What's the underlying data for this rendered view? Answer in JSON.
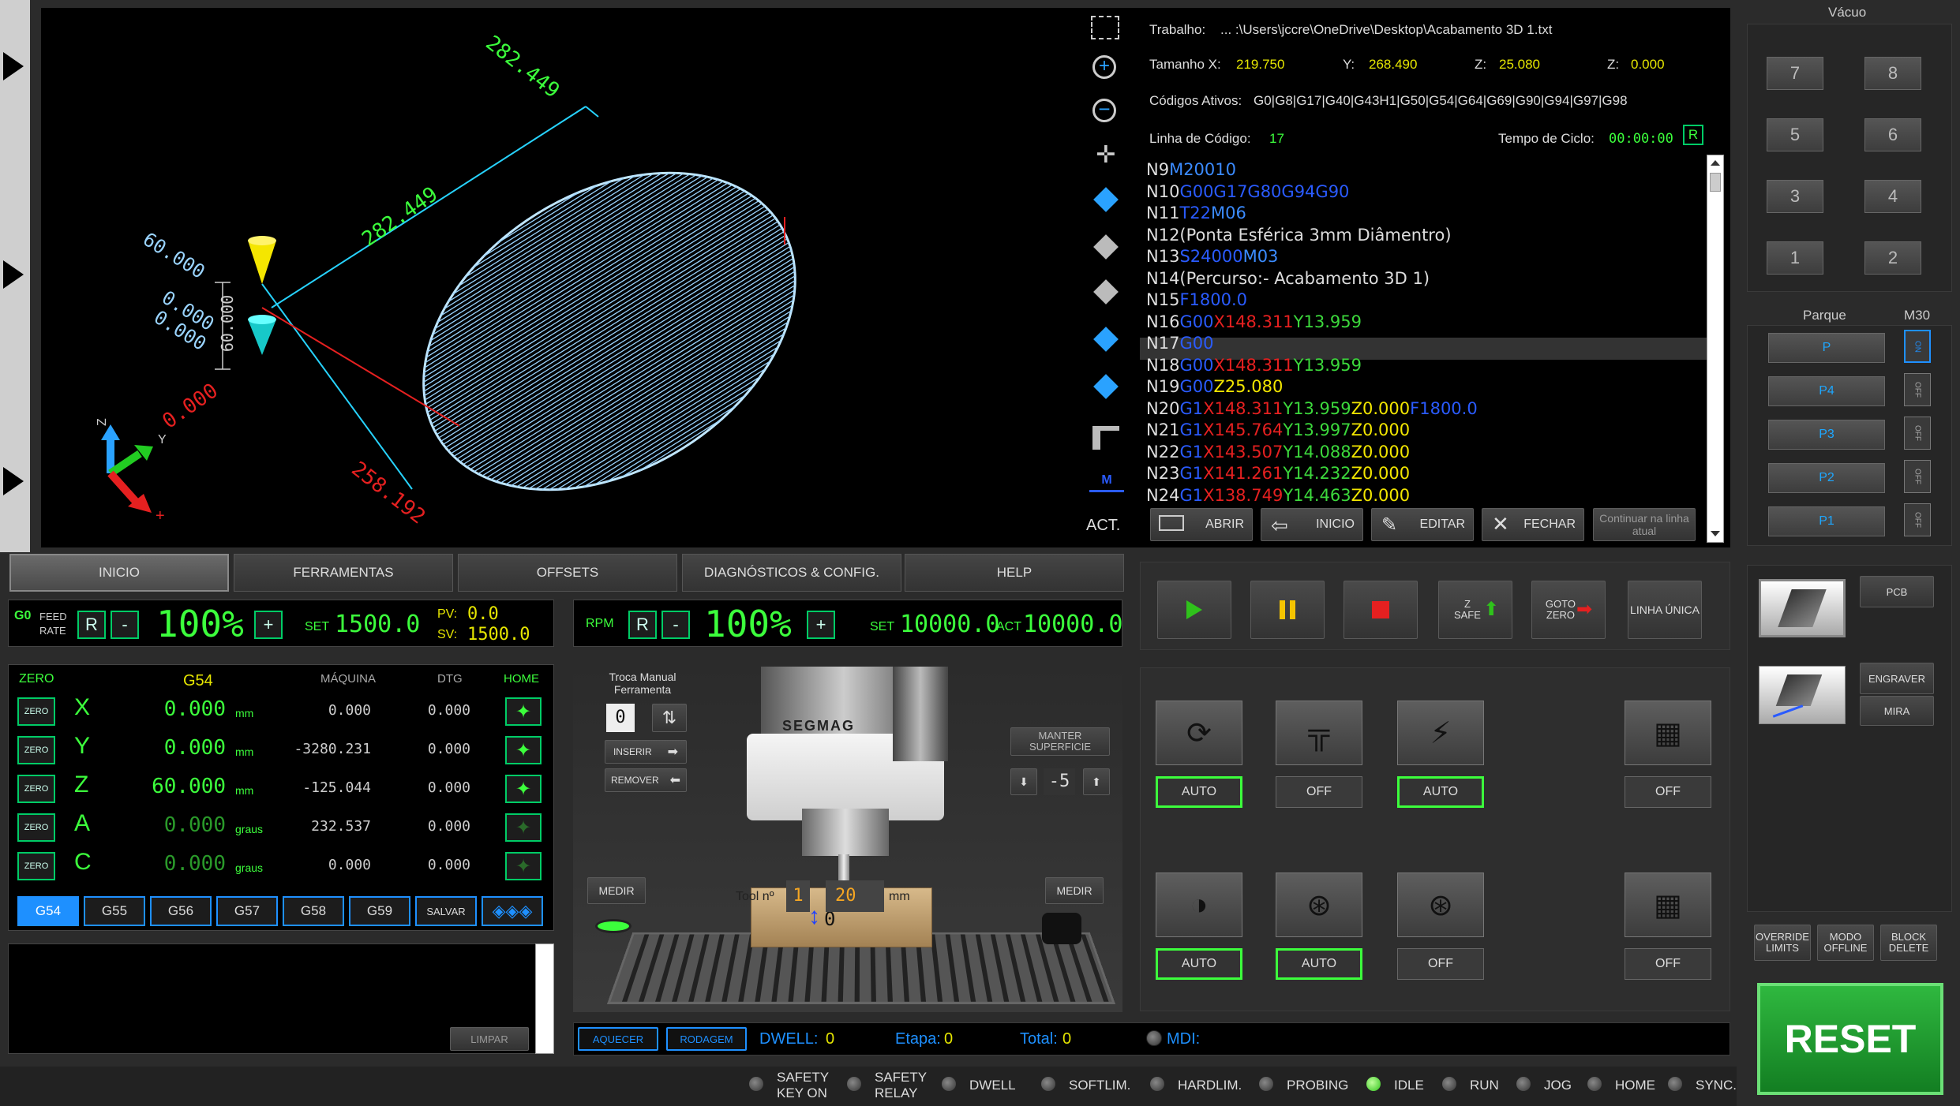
{
  "vacuum": {
    "title": "Vácuo",
    "buttons": [
      "7",
      "8",
      "5",
      "6",
      "3",
      "4",
      "1",
      "2"
    ]
  },
  "park": {
    "title": "Parque",
    "m30": "M30",
    "buttons": [
      "P",
      "P4",
      "P3",
      "P2",
      "P1"
    ],
    "toggle_on": "ON",
    "toggle_off": "OFF"
  },
  "right_buttons": {
    "pcb": "PCB",
    "engraver": "ENGRAVER",
    "mira": "MIRA",
    "override": "OVERRIDE LIMITS",
    "offline": "MODO OFFLINE",
    "block": "BLOCK DELETE",
    "reset": "RESET"
  },
  "file": {
    "label_job": "Trabalho:",
    "path": "... :\\Users\\jccre\\OneDrive\\Desktop\\Acabamento 3D 1.txt",
    "label_size": "Tamanho X:",
    "size_x": "219.750",
    "label_y": "Y:",
    "size_y": "268.490",
    "label_z": "Z:",
    "size_z": "25.080",
    "label_z2": "Z:",
    "size_z2": "0.000",
    "label_codes": "Códigos Ativos:",
    "codes": "G0|G8|G17|G40|G43H1|G50|G54|G64|G69|G90|G94|G97|G98",
    "label_line": "Linha de Código:",
    "line": "17",
    "label_cycle": "Tempo de Ciclo:",
    "cycle": "00:00:00",
    "reset_small": "R"
  },
  "gcode_lines": [
    [
      [
        "N9",
        "#ddd"
      ],
      [
        "M20010",
        "#3b8bff"
      ]
    ],
    [
      [
        "N10",
        "#ddd"
      ],
      [
        "G00G17G80G94G90",
        "#2a5bff"
      ]
    ],
    [
      [
        "N11",
        "#ddd"
      ],
      [
        "T22",
        "#2a5bff"
      ],
      [
        "M06",
        "#3b8bff"
      ]
    ],
    [
      [
        "N12(Ponta Esférica 3mm Diâmentro)",
        "#ddd"
      ]
    ],
    [
      [
        "N13",
        "#ddd"
      ],
      [
        "S24000",
        "#2a5bff"
      ],
      [
        "M03",
        "#3b8bff"
      ]
    ],
    [
      [
        "N14(Percurso:- Acabamento 3D 1)",
        "#ddd"
      ]
    ],
    [
      [
        "N15",
        "#ddd"
      ],
      [
        "F1800.0",
        "#2a5bff"
      ]
    ],
    [
      [
        "N16",
        "#ddd"
      ],
      [
        "G00",
        "#2a5bff"
      ],
      [
        "X148.311",
        "#e52020"
      ],
      [
        "Y13.959",
        "#3cd83c"
      ]
    ],
    [
      [
        "N17",
        "#ddd"
      ],
      [
        "G00",
        "#2a5bff"
      ]
    ],
    [
      [
        "N18",
        "#ddd"
      ],
      [
        "G00",
        "#2a5bff"
      ],
      [
        "X148.311",
        "#e52020"
      ],
      [
        "Y13.959",
        "#3cd83c"
      ]
    ],
    [
      [
        "N19",
        "#ddd"
      ],
      [
        "G00",
        "#2a5bff"
      ],
      [
        "Z25.080",
        "#f2e600"
      ]
    ],
    [
      [
        "N20",
        "#ddd"
      ],
      [
        "G1",
        "#2a5bff"
      ],
      [
        "X148.311",
        "#e52020"
      ],
      [
        "Y13.959",
        "#3cd83c"
      ],
      [
        "Z0.000",
        "#f2e600"
      ],
      [
        "F1800.0",
        "#2a5bff"
      ]
    ],
    [
      [
        "N21",
        "#ddd"
      ],
      [
        "G1",
        "#2a5bff"
      ],
      [
        "X145.764",
        "#e52020"
      ],
      [
        "Y13.997",
        "#3cd83c"
      ],
      [
        "Z0.000",
        "#f2e600"
      ]
    ],
    [
      [
        "N22",
        "#ddd"
      ],
      [
        "G1",
        "#2a5bff"
      ],
      [
        "X143.507",
        "#e52020"
      ],
      [
        "Y14.088",
        "#3cd83c"
      ],
      [
        "Z0.000",
        "#f2e600"
      ]
    ],
    [
      [
        "N23",
        "#ddd"
      ],
      [
        "G1",
        "#2a5bff"
      ],
      [
        "X141.261",
        "#e52020"
      ],
      [
        "Y14.232",
        "#3cd83c"
      ],
      [
        "Z0.000",
        "#f2e600"
      ]
    ],
    [
      [
        "N24",
        "#ddd"
      ],
      [
        "G1",
        "#2a5bff"
      ],
      [
        "X138.749",
        "#e52020"
      ],
      [
        "Y14.463",
        "#3cd83c"
      ],
      [
        "Z0.000",
        "#f2e600"
      ]
    ]
  ],
  "file_buttons": {
    "open": "ABRIR",
    "start": "INICIO",
    "edit": "EDITAR",
    "close": "FECHAR",
    "continue": "Continuar na linha atual"
  },
  "viewer": {
    "dim1": "282.449",
    "dim2": "282.449",
    "dim3": "60.000",
    "dim4": "0.000",
    "dim5": "0.000",
    "dim6": "60.000",
    "dim7": "0.000",
    "dim8": "258.192",
    "act": "ACT."
  },
  "tabs": [
    "INICIO",
    "FERRAMENTAS",
    "OFFSETS",
    "DIAGNÓSTICOS & CONFIG.",
    "HELP"
  ],
  "feed": {
    "g0": "G0",
    "feed": "FEED",
    "rate": "RATE",
    "r": "R",
    "minus": "-",
    "plus": "+",
    "pct": "100%",
    "set_lbl": "SET",
    "set": "1500.0",
    "pv_lbl": "PV:",
    "pv": "0.0",
    "sv_lbl": "SV:",
    "sv": "1500.0"
  },
  "rpm": {
    "label": "RPM",
    "r": "R",
    "minus": "-",
    "plus": "+",
    "pct": "100%",
    "set_lbl": "SET",
    "set": "10000.0",
    "act_lbl": "ACT",
    "act": "10000.0"
  },
  "dro": {
    "zero": "ZERO",
    "wcs": "G54",
    "machine": "MÁQUINA",
    "dtg": "DTG",
    "home": "HOME",
    "axes": [
      {
        "name": "X",
        "value": "0.000",
        "unit": "mm",
        "machine": "0.000",
        "dtg": "0.000"
      },
      {
        "name": "Y",
        "value": "0.000",
        "unit": "mm",
        "machine": "-3280.231",
        "dtg": "0.000"
      },
      {
        "name": "Z",
        "value": "60.000",
        "unit": "mm",
        "machine": "-125.044",
        "dtg": "0.000"
      },
      {
        "name": "A",
        "value": "0.000",
        "unit": "graus",
        "machine": "232.537",
        "dtg": "0.000"
      },
      {
        "name": "C",
        "value": "0.000",
        "unit": "graus",
        "machine": "0.000",
        "dtg": "0.000"
      }
    ],
    "wcs_buttons": [
      "G54",
      "G55",
      "G56",
      "G57",
      "G58",
      "G59",
      "SALVAR"
    ]
  },
  "console": {
    "clear": "LIMPAR"
  },
  "toolchange": {
    "title": "Troca Manual Ferramenta",
    "tool": "0",
    "insert": "INSERIR",
    "remove": "REMOVER",
    "brand": "SEGMAG",
    "keep": "MANTER SUPERFICIE",
    "offset": "-5",
    "measure": "MEDIR",
    "tool_no": "Tool nº",
    "tool_val": "1",
    "len": "20",
    "mm": "mm",
    "zval": "0"
  },
  "bottom": {
    "heat": "AQUECER",
    "break": "RODAGEM",
    "dwell_lbl": "DWELL:",
    "dwell": "0",
    "stage_lbl": "Etapa:",
    "stage": "0",
    "total_lbl": "Total:",
    "total": "0",
    "mdi": "MDI:"
  },
  "run": {
    "zsafe": "Z SAFE",
    "gotozero": "GOTO ZERO",
    "single": "LINHA ÚNICA"
  },
  "aux": {
    "auto": "AUTO",
    "off": "OFF"
  },
  "status": [
    "SAFETY KEY ON",
    "SAFETY RELAY",
    "DWELL",
    "SOFTLIM.",
    "HARDLIM.",
    "PROBING",
    "IDLE",
    "RUN",
    "JOG",
    "HOME",
    "SYNC."
  ]
}
